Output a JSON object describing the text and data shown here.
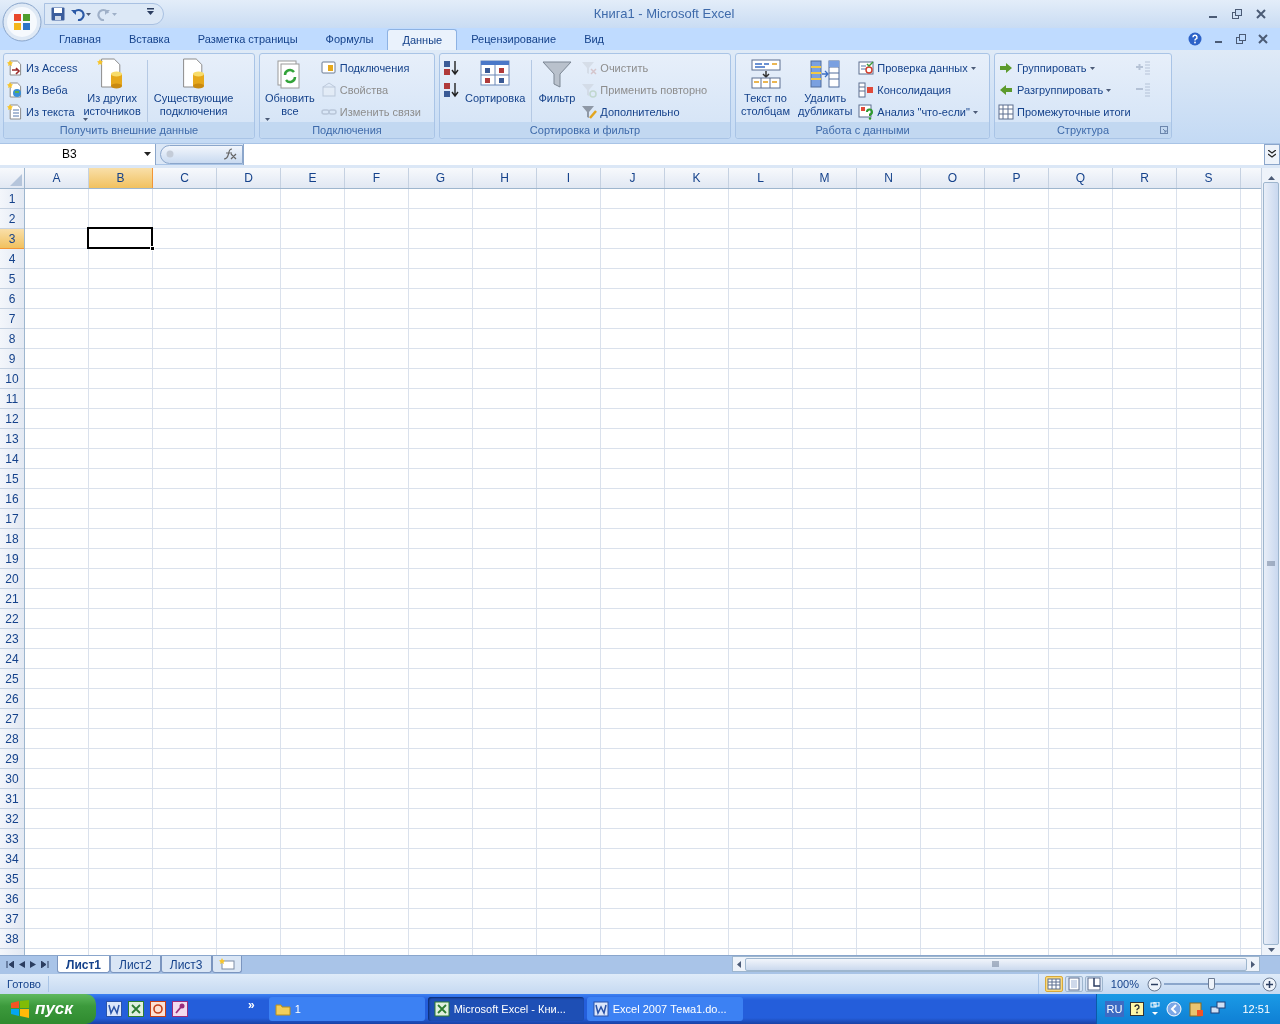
{
  "window": {
    "title": "Книга1 - Microsoft Excel"
  },
  "tabs": [
    {
      "label": "Главная",
      "selected": false
    },
    {
      "label": "Вставка",
      "selected": false
    },
    {
      "label": "Разметка страницы",
      "selected": false
    },
    {
      "label": "Формулы",
      "selected": false
    },
    {
      "label": "Данные",
      "selected": true
    },
    {
      "label": "Рецензирование",
      "selected": false
    },
    {
      "label": "Вид",
      "selected": false
    }
  ],
  "ribbon_groups": [
    {
      "title": "Получить внешние данные",
      "dialog_launcher": false,
      "columns": [
        {
          "kind": "stack",
          "items": [
            {
              "label": "Из Access",
              "disabled": false,
              "dropdown": false
            },
            {
              "label": "Из Веба",
              "disabled": false,
              "dropdown": false
            },
            {
              "label": "Из текста",
              "disabled": false,
              "dropdown": false
            }
          ]
        },
        {
          "kind": "large",
          "items": [
            {
              "label": "Из других\nисточников",
              "disabled": false,
              "dropdown": true
            }
          ]
        },
        {
          "kind": "separator"
        },
        {
          "kind": "large",
          "items": [
            {
              "label": "Существующие\nподключения",
              "disabled": false,
              "dropdown": false
            }
          ]
        }
      ]
    },
    {
      "title": "Подключения",
      "dialog_launcher": false,
      "columns": [
        {
          "kind": "large",
          "items": [
            {
              "label": "Обновить\nвсе",
              "disabled": false,
              "dropdown": true
            }
          ]
        },
        {
          "kind": "stack",
          "items": [
            {
              "label": "Подключения",
              "disabled": false,
              "dropdown": false
            },
            {
              "label": "Свойства",
              "disabled": true,
              "dropdown": false
            },
            {
              "label": "Изменить связи",
              "disabled": true,
              "dropdown": false
            }
          ]
        }
      ]
    },
    {
      "title": "Сортировка и фильтр",
      "dialog_launcher": false,
      "columns": [
        {
          "kind": "stack",
          "items": [
            {
              "disabled": false,
              "dropdown": false
            },
            {
              "disabled": false,
              "dropdown": false
            }
          ]
        },
        {
          "kind": "large",
          "items": [
            {
              "label": "Сортировка",
              "disabled": false,
              "dropdown": false
            }
          ]
        },
        {
          "kind": "separator"
        },
        {
          "kind": "large",
          "items": [
            {
              "label": "Фильтр",
              "disabled": false,
              "dropdown": false
            }
          ]
        },
        {
          "kind": "stack",
          "items": [
            {
              "label": "Очистить",
              "disabled": true,
              "dropdown": false
            },
            {
              "label": "Применить повторно",
              "disabled": true,
              "dropdown": false
            },
            {
              "label": "Дополнительно",
              "disabled": false,
              "dropdown": false
            }
          ]
        }
      ]
    },
    {
      "title": "Работа с данными",
      "dialog_launcher": false,
      "columns": [
        {
          "kind": "large",
          "items": [
            {
              "label": "Текст по\nстолбцам",
              "disabled": false,
              "dropdown": false
            }
          ]
        },
        {
          "kind": "large",
          "items": [
            {
              "label": "Удалить\nдубликаты",
              "disabled": false,
              "dropdown": false
            }
          ]
        },
        {
          "kind": "stack",
          "items": [
            {
              "label": "Проверка данных",
              "disabled": false,
              "dropdown": true
            },
            {
              "label": "Консолидация",
              "disabled": false,
              "dropdown": false
            },
            {
              "label": "Анализ \"что-если\"",
              "disabled": false,
              "dropdown": true
            }
          ]
        }
      ]
    },
    {
      "title": "Структура",
      "dialog_launcher": true,
      "columns": [
        {
          "kind": "stack",
          "items": [
            {
              "label": "Группировать",
              "disabled": false,
              "dropdown": true
            },
            {
              "label": "Разгруппировать",
              "disabled": false,
              "dropdown": true
            },
            {
              "label": "Промежуточные итоги",
              "disabled": false,
              "dropdown": false
            }
          ]
        },
        {
          "kind": "stack",
          "items": [
            {
              "disabled": true,
              "dropdown": false
            },
            {
              "disabled": true,
              "dropdown": false
            }
          ]
        }
      ]
    }
  ],
  "name_box": {
    "value": "B3"
  },
  "columns": [
    {
      "label": "A",
      "selected": false
    },
    {
      "label": "B",
      "selected": true
    },
    {
      "label": "C",
      "selected": false
    },
    {
      "label": "D",
      "selected": false
    },
    {
      "label": "E",
      "selected": false
    },
    {
      "label": "F",
      "selected": false
    },
    {
      "label": "G",
      "selected": false
    },
    {
      "label": "H",
      "selected": false
    },
    {
      "label": "I",
      "selected": false
    },
    {
      "label": "J",
      "selected": false
    },
    {
      "label": "K",
      "selected": false
    },
    {
      "label": "L",
      "selected": false
    },
    {
      "label": "M",
      "selected": false
    },
    {
      "label": "N",
      "selected": false
    },
    {
      "label": "O",
      "selected": false
    },
    {
      "label": "P",
      "selected": false
    },
    {
      "label": "Q",
      "selected": false
    },
    {
      "label": "R",
      "selected": false
    },
    {
      "label": "S",
      "selected": false
    }
  ],
  "rows": [
    {
      "label": "1",
      "selected": false
    },
    {
      "label": "2",
      "selected": false
    },
    {
      "label": "3",
      "selected": true
    },
    {
      "label": "4",
      "selected": false
    },
    {
      "label": "5",
      "selected": false
    },
    {
      "label": "6",
      "selected": false
    },
    {
      "label": "7",
      "selected": false
    },
    {
      "label": "8",
      "selected": false
    },
    {
      "label": "9",
      "selected": false
    },
    {
      "label": "10",
      "selected": false
    },
    {
      "label": "11",
      "selected": false
    },
    {
      "label": "12",
      "selected": false
    },
    {
      "label": "13",
      "selected": false
    },
    {
      "label": "14",
      "selected": false
    },
    {
      "label": "15",
      "selected": false
    },
    {
      "label": "16",
      "selected": false
    },
    {
      "label": "17",
      "selected": false
    },
    {
      "label": "18",
      "selected": false
    },
    {
      "label": "19",
      "selected": false
    },
    {
      "label": "20",
      "selected": false
    },
    {
      "label": "21",
      "selected": false
    },
    {
      "label": "22",
      "selected": false
    },
    {
      "label": "23",
      "selected": false
    },
    {
      "label": "24",
      "selected": false
    },
    {
      "label": "25",
      "selected": false
    },
    {
      "label": "26",
      "selected": false
    },
    {
      "label": "27",
      "selected": false
    },
    {
      "label": "28",
      "selected": false
    },
    {
      "label": "29",
      "selected": false
    },
    {
      "label": "30",
      "selected": false
    },
    {
      "label": "31",
      "selected": false
    },
    {
      "label": "32",
      "selected": false
    },
    {
      "label": "33",
      "selected": false
    },
    {
      "label": "34",
      "selected": false
    },
    {
      "label": "35",
      "selected": false
    },
    {
      "label": "36",
      "selected": false
    },
    {
      "label": "37",
      "selected": false
    },
    {
      "label": "38",
      "selected": false
    }
  ],
  "sheet_tabs": [
    {
      "label": "Лист1",
      "selected": true
    },
    {
      "label": "Лист2",
      "selected": false
    },
    {
      "label": "Лист3",
      "selected": false
    }
  ],
  "status_bar": {
    "text": "Готово",
    "views": [
      {
        "selected": true
      },
      {
        "selected": false
      },
      {
        "selected": false
      }
    ],
    "zoom": "100%",
    "zoom_slider": {
      "level": 0.5
    }
  },
  "taskbar": {
    "start": "пуск",
    "overflow": "»",
    "tasks": [
      {
        "label": "1",
        "selected": false
      },
      {
        "label": "Microsoft Excel - Кни...",
        "selected": true
      },
      {
        "label": "Excel 2007 Тема1.do...",
        "selected": false
      }
    ],
    "language": "RU",
    "clock": "12:51"
  }
}
